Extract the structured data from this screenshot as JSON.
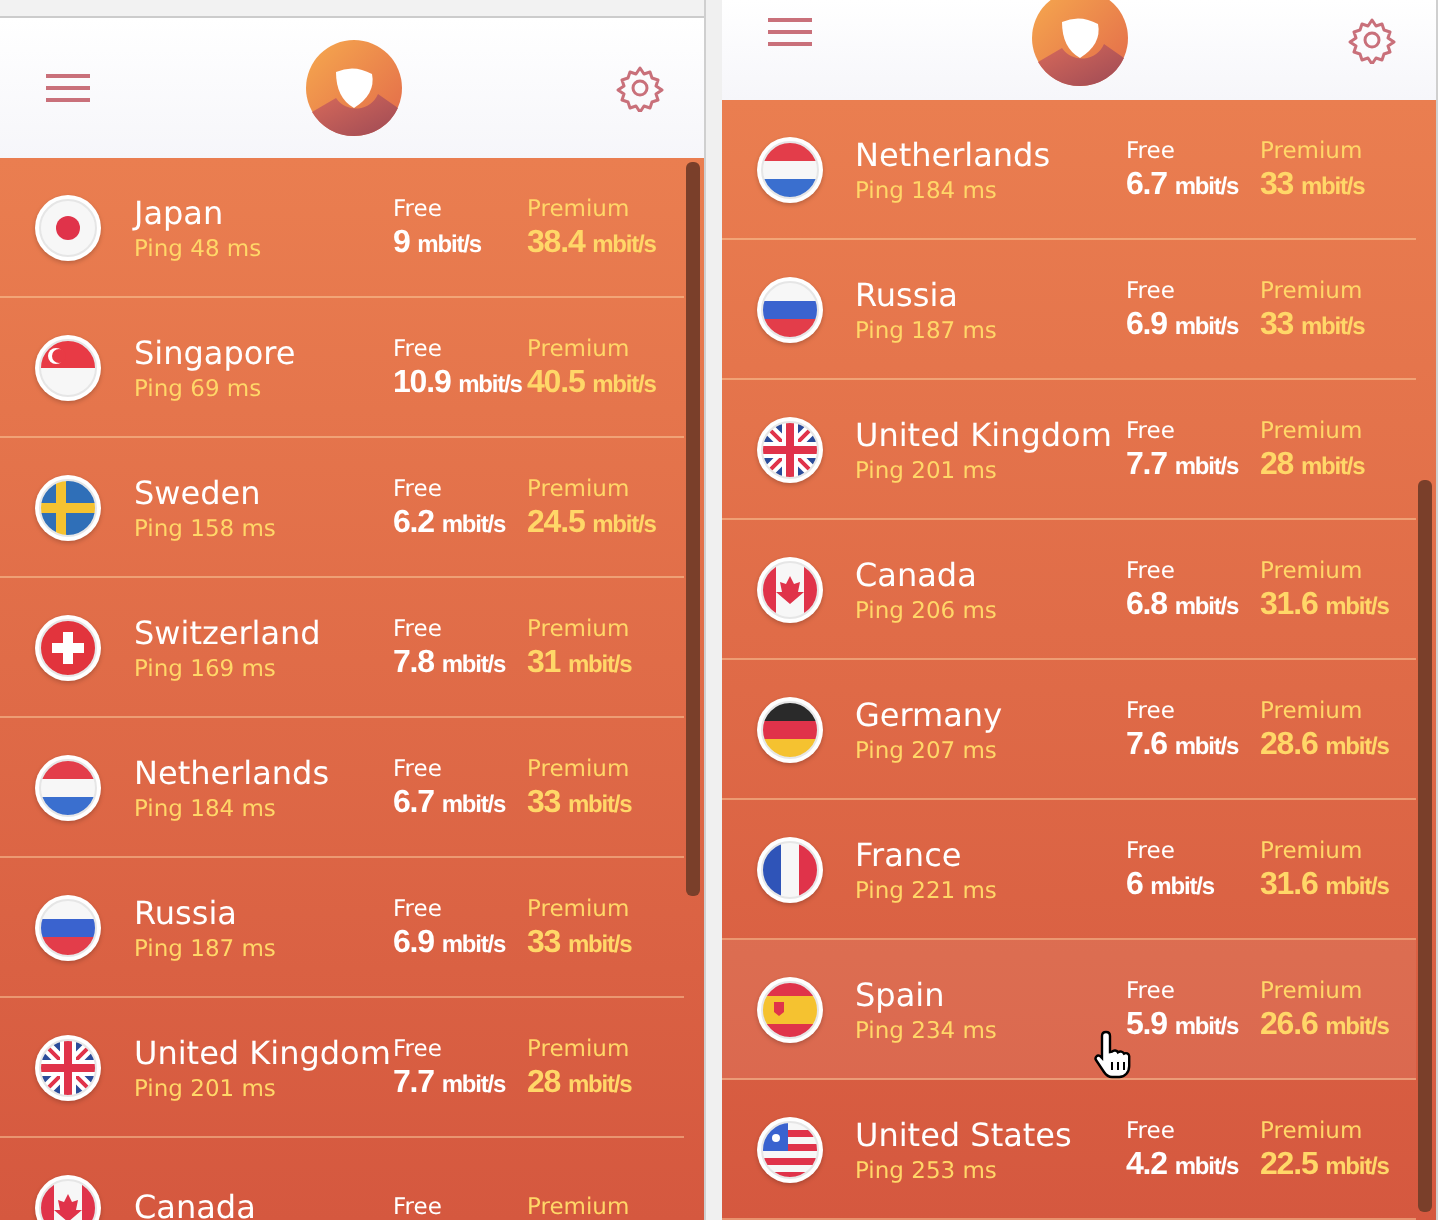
{
  "panels": [
    {
      "kind": "full",
      "rows": [
        {
          "kind": "japan",
          "country": "Japan",
          "ping": "Ping 48 ms",
          "free_label": "Free",
          "free_value": "9",
          "free_unit": "mbit/s",
          "premium_label": "Premium",
          "premium_value": "38.4",
          "premium_unit": "mbit/s",
          "hovered": false
        },
        {
          "kind": "singapore",
          "country": "Singapore",
          "ping": "Ping 69 ms",
          "free_label": "Free",
          "free_value": "10.9",
          "free_unit": "mbit/s",
          "premium_label": "Premium",
          "premium_value": "40.5",
          "premium_unit": "mbit/s",
          "hovered": false
        },
        {
          "kind": "sweden",
          "country": "Sweden",
          "ping": "Ping 158 ms",
          "free_label": "Free",
          "free_value": "6.2",
          "free_unit": "mbit/s",
          "premium_label": "Premium",
          "premium_value": "24.5",
          "premium_unit": "mbit/s",
          "hovered": false
        },
        {
          "kind": "switzerland",
          "country": "Switzerland",
          "ping": "Ping 169 ms",
          "free_label": "Free",
          "free_value": "7.8",
          "free_unit": "mbit/s",
          "premium_label": "Premium",
          "premium_value": "31",
          "premium_unit": "mbit/s",
          "hovered": false
        },
        {
          "kind": "netherlands",
          "country": "Netherlands",
          "ping": "Ping 184 ms",
          "free_label": "Free",
          "free_value": "6.7",
          "free_unit": "mbit/s",
          "premium_label": "Premium",
          "premium_value": "33",
          "premium_unit": "mbit/s",
          "hovered": false
        },
        {
          "kind": "russia",
          "country": "Russia",
          "ping": "Ping 187 ms",
          "free_label": "Free",
          "free_value": "6.9",
          "free_unit": "mbit/s",
          "premium_label": "Premium",
          "premium_value": "33",
          "premium_unit": "mbit/s",
          "hovered": false
        },
        {
          "kind": "uk",
          "country": "United Kingdom",
          "ping": "Ping 201 ms",
          "free_label": "Free",
          "free_value": "7.7",
          "free_unit": "mbit/s",
          "premium_label": "Premium",
          "premium_value": "28",
          "premium_unit": "mbit/s",
          "hovered": false
        },
        {
          "kind": "canada",
          "country": "Canada",
          "free_label": "Free",
          "premium_label": "Premium",
          "hovered": false
        }
      ]
    },
    {
      "kind": "scrolled",
      "rows": [
        {
          "kind": "netherlands",
          "country": "Netherlands",
          "ping": "Ping 184 ms",
          "free_label": "Free",
          "free_value": "6.7",
          "free_unit": "mbit/s",
          "premium_label": "Premium",
          "premium_value": "33",
          "premium_unit": "mbit/s",
          "hovered": false
        },
        {
          "kind": "russia",
          "country": "Russia",
          "ping": "Ping 187 ms",
          "free_label": "Free",
          "free_value": "6.9",
          "free_unit": "mbit/s",
          "premium_label": "Premium",
          "premium_value": "33",
          "premium_unit": "mbit/s",
          "hovered": false
        },
        {
          "kind": "uk",
          "country": "United Kingdom",
          "ping": "Ping 201 ms",
          "free_label": "Free",
          "free_value": "7.7",
          "free_unit": "mbit/s",
          "premium_label": "Premium",
          "premium_value": "28",
          "premium_unit": "mbit/s",
          "hovered": false
        },
        {
          "kind": "canada",
          "country": "Canada",
          "ping": "Ping 206 ms",
          "free_label": "Free",
          "free_value": "6.8",
          "free_unit": "mbit/s",
          "premium_label": "Premium",
          "premium_value": "31.6",
          "premium_unit": "mbit/s",
          "hovered": false
        },
        {
          "kind": "germany",
          "country": "Germany",
          "ping": "Ping 207 ms",
          "free_label": "Free",
          "free_value": "7.6",
          "free_unit": "mbit/s",
          "premium_label": "Premium",
          "premium_value": "28.6",
          "premium_unit": "mbit/s",
          "hovered": false
        },
        {
          "kind": "france",
          "country": "France",
          "ping": "Ping 221 ms",
          "free_label": "Free",
          "free_value": "6",
          "free_unit": "mbit/s",
          "premium_label": "Premium",
          "premium_value": "31.6",
          "premium_unit": "mbit/s",
          "hovered": false
        },
        {
          "kind": "spain",
          "country": "Spain",
          "ping": "Ping 234 ms",
          "free_label": "Free",
          "free_value": "5.9",
          "free_unit": "mbit/s",
          "premium_label": "Premium",
          "premium_value": "26.6",
          "premium_unit": "mbit/s",
          "hovered": true
        },
        {
          "kind": "usa",
          "country": "United States",
          "ping": "Ping 253 ms",
          "free_label": "Free",
          "free_value": "4.2",
          "free_unit": "mbit/s",
          "premium_label": "Premium",
          "premium_value": "22.5",
          "premium_unit": "mbit/s",
          "hovered": false
        }
      ]
    }
  ]
}
